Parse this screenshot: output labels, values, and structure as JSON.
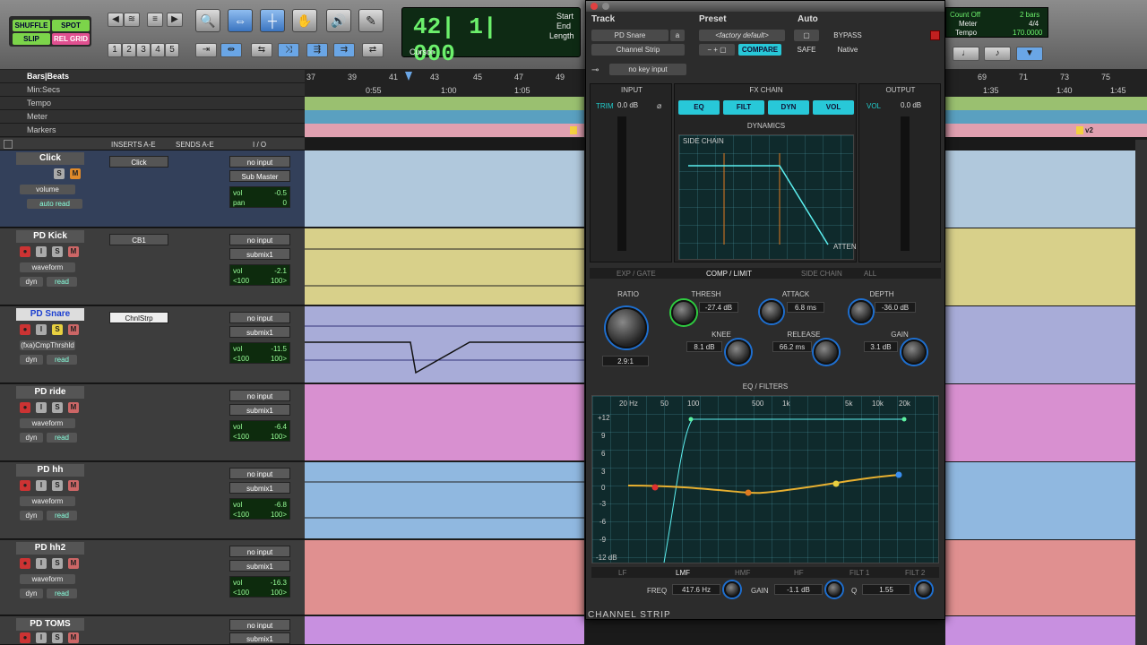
{
  "toolbar": {
    "modes": [
      "SHUFFLE",
      "SPOT",
      "SLIP",
      "REL GRID"
    ],
    "zoom_presets": [
      "1",
      "2",
      "3",
      "4",
      "5"
    ],
    "counter_main": "42| 1| 000",
    "counter_labels": {
      "start": "Start",
      "end": "End",
      "length": "Length",
      "cursor": "Cursor"
    },
    "right": {
      "count_off": "Count Off",
      "bars": "2 bars",
      "meter_label": "Meter",
      "meter": "4/4",
      "tempo_label": "Tempo",
      "tempo": "170.0000"
    }
  },
  "rulers": {
    "labels": [
      "Bars|Beats",
      "Min:Secs",
      "Tempo",
      "Meter",
      "Markers"
    ],
    "bars": [
      "37",
      "39",
      "41",
      "43",
      "45",
      "47",
      "49",
      "69",
      "71",
      "73",
      "75"
    ],
    "secs": [
      "0:55",
      "1:00",
      "1:05",
      "1:35",
      "1:40",
      "1:45"
    ],
    "marker_v2": "v2"
  },
  "track_header": {
    "inserts": "INSERTS A-E",
    "sends": "SENDS A-E",
    "io": "I / O"
  },
  "tracks": [
    {
      "name": "Click",
      "insert": "Click",
      "input": "no input",
      "output": "Sub Master",
      "view": "volume",
      "auto": "auto read",
      "vol": "-0.5",
      "pan_label": "pan",
      "pan": "0"
    },
    {
      "name": "PD Kick",
      "insert": "CB1",
      "input": "no input",
      "output": "submix1",
      "view": "waveform",
      "dyn": "dyn",
      "auto": "read",
      "vol": "-2.1",
      "pan_l": "<100",
      "pan_r": "100>"
    },
    {
      "name": "PD Snare",
      "insert": "ChnlStrp",
      "input": "no input",
      "output": "submix1",
      "view": "(fxa)CmpThrshld",
      "dyn": "dyn",
      "auto": "read",
      "vol": "-11.5",
      "pan_l": "<100",
      "pan_r": "100>"
    },
    {
      "name": "PD ride",
      "insert": "",
      "input": "no input",
      "output": "submix1",
      "view": "waveform",
      "dyn": "dyn",
      "auto": "read",
      "vol": "-6.4",
      "pan_l": "<100",
      "pan_r": "100>"
    },
    {
      "name": "PD hh",
      "insert": "",
      "input": "no input",
      "output": "submix1",
      "view": "waveform",
      "dyn": "dyn",
      "auto": "read",
      "vol": "-6.8",
      "pan_l": "<100",
      "pan_r": "100>"
    },
    {
      "name": "PD hh2",
      "insert": "",
      "input": "no input",
      "output": "submix1",
      "view": "waveform",
      "dyn": "dyn",
      "auto": "read",
      "vol": "-16.3",
      "pan_l": "<100",
      "pan_r": "100>"
    },
    {
      "name": "PD TOMS",
      "insert": "",
      "input": "no input",
      "output": "submix1"
    }
  ],
  "plugin": {
    "track_label": "Track",
    "preset_label": "Preset",
    "auto_label": "Auto",
    "track": "PD Snare",
    "track_suffix": "a",
    "preset": "<factory default>",
    "plugin_name": "Channel Strip",
    "compare": "COMPARE",
    "safe": "SAFE",
    "bypass": "BYPASS",
    "native": "Native",
    "key_input": "no key input",
    "input_label": "INPUT",
    "fxchain_label": "FX CHAIN",
    "output_label": "OUTPUT",
    "trim_label": "TRIM",
    "trim_val": "0.0 dB",
    "vol_label": "VOL",
    "vol_val": "0.0 dB",
    "modules": [
      "EQ",
      "FILT",
      "DYN",
      "VOL"
    ],
    "dynamics_label": "DYNAMICS",
    "side_chain": "SIDE CHAIN",
    "atten": "ATTEN",
    "dyn_tabs": [
      "EXP / GATE",
      "COMP / LIMIT",
      "SIDE CHAIN",
      "ALL"
    ],
    "knobs": {
      "ratio": {
        "label": "RATIO",
        "value": "2.9:1"
      },
      "thresh": {
        "label": "THRESH",
        "value": "-27.4 dB"
      },
      "attack": {
        "label": "ATTACK",
        "value": "6.8 ms"
      },
      "depth": {
        "label": "DEPTH",
        "value": "-36.0 dB"
      },
      "knee": {
        "label": "KNEE",
        "value": "8.1 dB"
      },
      "release": {
        "label": "RELEASE",
        "value": "66.2 ms"
      },
      "gain": {
        "label": "GAIN",
        "value": "3.1 dB"
      }
    },
    "eq_label": "EQ / FILTERS",
    "eq_freqs": [
      "20 Hz",
      "50",
      "100",
      "500",
      "1k",
      "5k",
      "10k",
      "20k"
    ],
    "eq_db": [
      "+12",
      "9",
      "6",
      "3",
      "0",
      "-3",
      "-6",
      "-9",
      "-12 dB"
    ],
    "bands": [
      "LF",
      "LMF",
      "HMF",
      "HF",
      "FILT 1",
      "FILT 2"
    ],
    "freq_label": "FREQ",
    "freq_val": "417.6 Hz",
    "gain_label": "GAIN",
    "gain_val": "-1.1 dB",
    "q_label": "Q",
    "q_val": "1.55",
    "footer": "CHANNEL STRIP"
  }
}
